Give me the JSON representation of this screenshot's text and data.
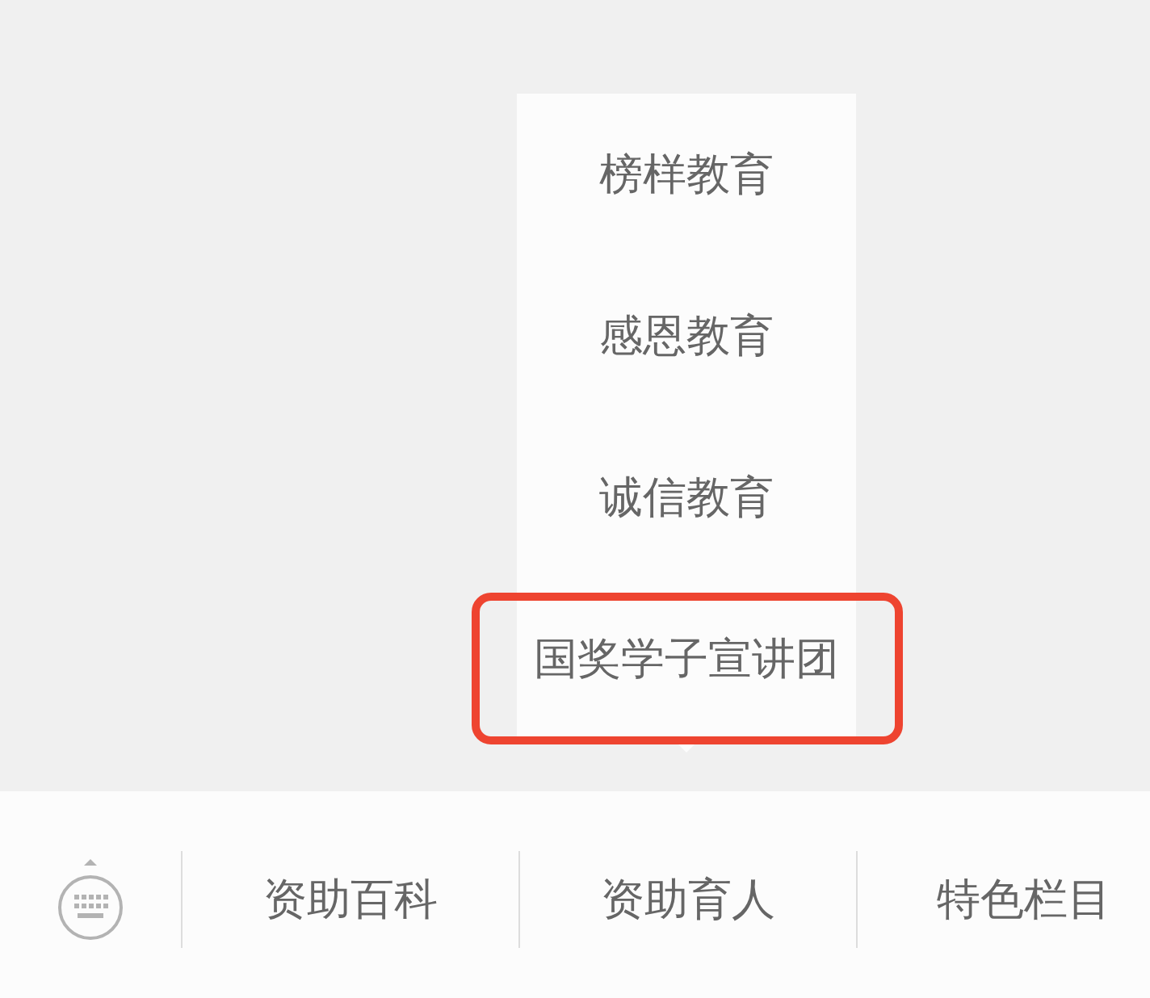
{
  "menu": {
    "items": [
      {
        "label": "榜样教育",
        "highlighted": false
      },
      {
        "label": "感恩教育",
        "highlighted": false
      },
      {
        "label": "诚信教育",
        "highlighted": false
      },
      {
        "label": "国奖学子宣讲团",
        "highlighted": true
      }
    ]
  },
  "bottom_bar": {
    "tabs": [
      {
        "label": "资助百科"
      },
      {
        "label": "资助育人"
      },
      {
        "label": "特色栏目"
      }
    ]
  }
}
